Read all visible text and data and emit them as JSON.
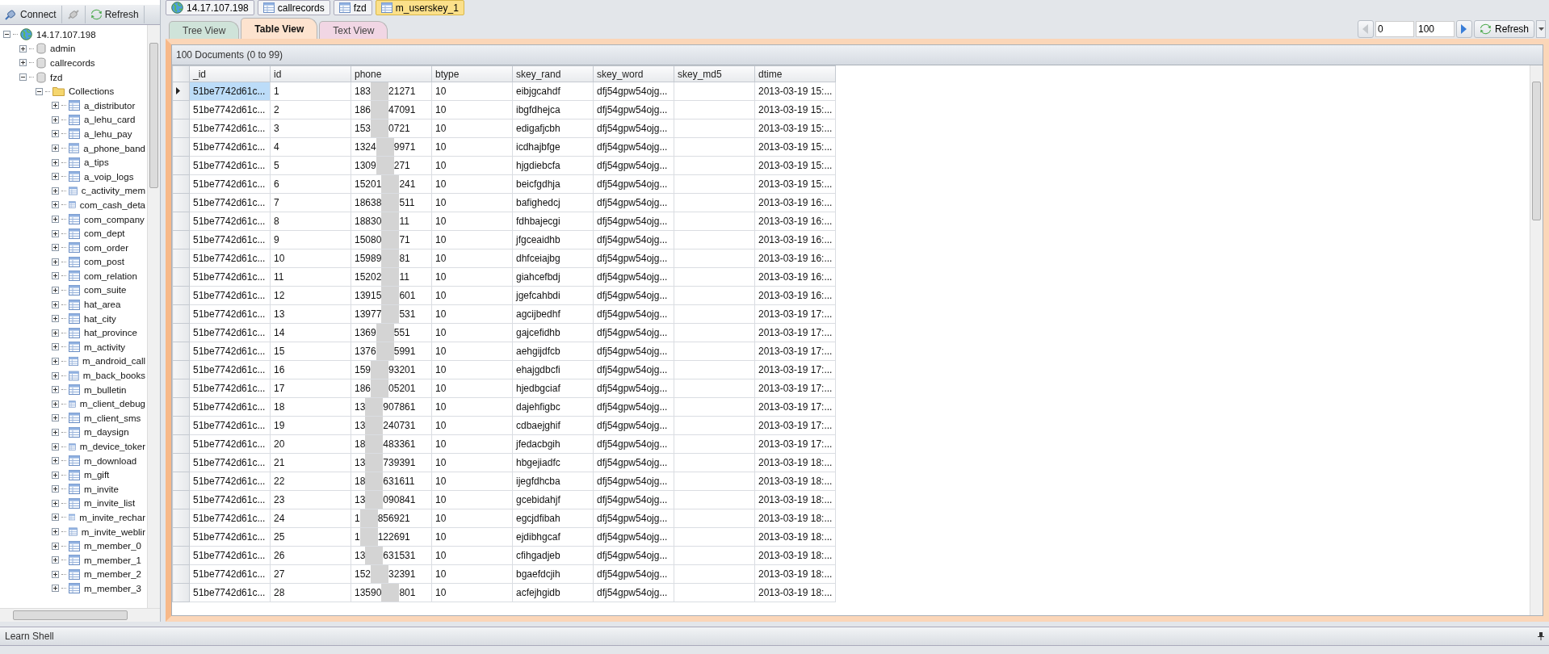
{
  "explorer": {
    "toolbar": [
      {
        "label": "Connect",
        "kind": "connect"
      },
      {
        "kind": "disconnect"
      },
      {
        "label": "Refresh",
        "kind": "refresh"
      }
    ],
    "tree": [
      {
        "label": "14.17.107.198",
        "kind": "server",
        "expanded": true,
        "children": [
          {
            "label": "admin",
            "kind": "database",
            "expanded": false
          },
          {
            "label": "callrecords",
            "kind": "database",
            "expanded": false
          },
          {
            "label": "fzd",
            "kind": "database",
            "expanded": true,
            "children": [
              {
                "label": "Collections",
                "kind": "folder",
                "expanded": true,
                "children": [
                  {
                    "label": "a_distributor",
                    "kind": "collection",
                    "expanded": false
                  },
                  {
                    "label": "a_lehu_card",
                    "kind": "collection",
                    "expanded": false
                  },
                  {
                    "label": "a_lehu_pay",
                    "kind": "collection",
                    "expanded": false
                  },
                  {
                    "label": "a_phone_band",
                    "kind": "collection",
                    "expanded": false
                  },
                  {
                    "label": "a_tips",
                    "kind": "collection",
                    "expanded": false
                  },
                  {
                    "label": "a_voip_logs",
                    "kind": "collection",
                    "expanded": false
                  },
                  {
                    "label": "c_activity_mem",
                    "kind": "collection",
                    "expanded": false
                  },
                  {
                    "label": "com_cash_deta",
                    "kind": "collection",
                    "expanded": false
                  },
                  {
                    "label": "com_company",
                    "kind": "collection",
                    "expanded": false
                  },
                  {
                    "label": "com_dept",
                    "kind": "collection",
                    "expanded": false
                  },
                  {
                    "label": "com_order",
                    "kind": "collection",
                    "expanded": false
                  },
                  {
                    "label": "com_post",
                    "kind": "collection",
                    "expanded": false
                  },
                  {
                    "label": "com_relation",
                    "kind": "collection",
                    "expanded": false
                  },
                  {
                    "label": "com_suite",
                    "kind": "collection",
                    "expanded": false
                  },
                  {
                    "label": "hat_area",
                    "kind": "collection",
                    "expanded": false
                  },
                  {
                    "label": "hat_city",
                    "kind": "collection",
                    "expanded": false
                  },
                  {
                    "label": "hat_province",
                    "kind": "collection",
                    "expanded": false
                  },
                  {
                    "label": "m_activity",
                    "kind": "collection",
                    "expanded": false
                  },
                  {
                    "label": "m_android_call",
                    "kind": "collection",
                    "expanded": false
                  },
                  {
                    "label": "m_back_books",
                    "kind": "collection",
                    "expanded": false
                  },
                  {
                    "label": "m_bulletin",
                    "kind": "collection",
                    "expanded": false
                  },
                  {
                    "label": "m_client_debug",
                    "kind": "collection",
                    "expanded": false
                  },
                  {
                    "label": "m_client_sms",
                    "kind": "collection",
                    "expanded": false
                  },
                  {
                    "label": "m_daysign",
                    "kind": "collection",
                    "expanded": false
                  },
                  {
                    "label": "m_device_toker",
                    "kind": "collection",
                    "expanded": false
                  },
                  {
                    "label": "m_download",
                    "kind": "collection",
                    "expanded": false
                  },
                  {
                    "label": "m_gift",
                    "kind": "collection",
                    "expanded": false
                  },
                  {
                    "label": "m_invite",
                    "kind": "collection",
                    "expanded": false
                  },
                  {
                    "label": "m_invite_list",
                    "kind": "collection",
                    "expanded": false
                  },
                  {
                    "label": "m_invite_rechar",
                    "kind": "collection",
                    "expanded": false
                  },
                  {
                    "label": "m_invite_weblir",
                    "kind": "collection",
                    "expanded": false
                  },
                  {
                    "label": "m_member_0",
                    "kind": "collection",
                    "expanded": false
                  },
                  {
                    "label": "m_member_1",
                    "kind": "collection",
                    "expanded": false
                  },
                  {
                    "label": "m_member_2",
                    "kind": "collection",
                    "expanded": false
                  },
                  {
                    "label": "m_member_3",
                    "kind": "collection",
                    "expanded": false
                  }
                ]
              }
            ]
          }
        ]
      }
    ]
  },
  "doc_tabs": [
    {
      "label": "14.17.107.198",
      "kind": "server",
      "selected": false
    },
    {
      "label": "callrecords",
      "kind": "collection",
      "selected": false
    },
    {
      "label": "fzd",
      "kind": "collection",
      "selected": false
    },
    {
      "label": "m_userskey_1",
      "kind": "collection",
      "selected": true
    }
  ],
  "view_tabs": [
    {
      "label": "Tree View",
      "color": "#cfe3d9",
      "selected": false
    },
    {
      "label": "Table View",
      "color": "#fde3cf",
      "selected": true
    },
    {
      "label": "Text View",
      "color": "#f1d6e4",
      "selected": false
    }
  ],
  "pager": {
    "skip": "0",
    "limit": "100",
    "refresh": "Refresh"
  },
  "table": {
    "summary": "100 Documents (0 to 99)",
    "columns": [
      "_id",
      "id",
      "phone",
      "btype",
      "skey_rand",
      "skey_word",
      "skey_md5",
      "dtime"
    ],
    "rows": [
      {
        "selected": true,
        "cells": [
          "51be7742d61c...",
          "1",
          "",
          "10",
          "eibjgcahdf",
          "dfj54gpw54ojg...",
          "",
          "2013-03-19 15:..."
        ],
        "phone": [
          "183",
          "21271"
        ]
      },
      {
        "selected": false,
        "cells": [
          "51be7742d61c...",
          "2",
          "",
          "10",
          "ibgfdhejca",
          "dfj54gpw54ojg...",
          "",
          "2013-03-19 15:..."
        ],
        "phone": [
          "186",
          "47091"
        ]
      },
      {
        "selected": false,
        "cells": [
          "51be7742d61c...",
          "3",
          "",
          "10",
          "edigafjcbh",
          "dfj54gpw54ojg...",
          "",
          "2013-03-19 15:..."
        ],
        "phone": [
          "153",
          "0721"
        ]
      },
      {
        "selected": false,
        "cells": [
          "51be7742d61c...",
          "4",
          "",
          "10",
          "icdhajbfge",
          "dfj54gpw54ojg...",
          "",
          "2013-03-19 15:..."
        ],
        "phone": [
          "1324",
          "9971"
        ]
      },
      {
        "selected": false,
        "cells": [
          "51be7742d61c...",
          "5",
          "",
          "10",
          "hjgdiebcfa",
          "dfj54gpw54ojg...",
          "",
          "2013-03-19 15:..."
        ],
        "phone": [
          "1309",
          "271"
        ]
      },
      {
        "selected": false,
        "cells": [
          "51be7742d61c...",
          "6",
          "",
          "10",
          "beicfgdhja",
          "dfj54gpw54ojg...",
          "",
          "2013-03-19 15:..."
        ],
        "phone": [
          "15201",
          "241"
        ]
      },
      {
        "selected": false,
        "cells": [
          "51be7742d61c...",
          "7",
          "",
          "10",
          "bafighedcj",
          "dfj54gpw54ojg...",
          "",
          "2013-03-19 16:..."
        ],
        "phone": [
          "18638",
          "511"
        ]
      },
      {
        "selected": false,
        "cells": [
          "51be7742d61c...",
          "8",
          "",
          "10",
          "fdhbajecgi",
          "dfj54gpw54ojg...",
          "",
          "2013-03-19 16:..."
        ],
        "phone": [
          "18830",
          "11"
        ]
      },
      {
        "selected": false,
        "cells": [
          "51be7742d61c...",
          "9",
          "",
          "10",
          "jfgceaidhb",
          "dfj54gpw54ojg...",
          "",
          "2013-03-19 16:..."
        ],
        "phone": [
          "15080",
          "71"
        ]
      },
      {
        "selected": false,
        "cells": [
          "51be7742d61c...",
          "10",
          "",
          "10",
          "dhfceiajbg",
          "dfj54gpw54ojg...",
          "",
          "2013-03-19 16:..."
        ],
        "phone": [
          "15989",
          "81"
        ]
      },
      {
        "selected": false,
        "cells": [
          "51be7742d61c...",
          "11",
          "",
          "10",
          "giahcefbdj",
          "dfj54gpw54ojg...",
          "",
          "2013-03-19 16:..."
        ],
        "phone": [
          "15202",
          "11"
        ]
      },
      {
        "selected": false,
        "cells": [
          "51be7742d61c...",
          "12",
          "",
          "10",
          "jgefcahbdi",
          "dfj54gpw54ojg...",
          "",
          "2013-03-19 16:..."
        ],
        "phone": [
          "13915",
          "601"
        ]
      },
      {
        "selected": false,
        "cells": [
          "51be7742d61c...",
          "13",
          "",
          "10",
          "agcijbedhf",
          "dfj54gpw54ojg...",
          "",
          "2013-03-19 17:..."
        ],
        "phone": [
          "13977",
          "531"
        ]
      },
      {
        "selected": false,
        "cells": [
          "51be7742d61c...",
          "14",
          "",
          "10",
          "gajcefidhb",
          "dfj54gpw54ojg...",
          "",
          "2013-03-19 17:..."
        ],
        "phone": [
          "1369",
          "551"
        ]
      },
      {
        "selected": false,
        "cells": [
          "51be7742d61c...",
          "15",
          "",
          "10",
          "aehgijdfcb",
          "dfj54gpw54ojg...",
          "",
          "2013-03-19 17:..."
        ],
        "phone": [
          "1376",
          "5991"
        ]
      },
      {
        "selected": false,
        "cells": [
          "51be7742d61c...",
          "16",
          "",
          "10",
          "ehajgdbcfi",
          "dfj54gpw54ojg...",
          "",
          "2013-03-19 17:..."
        ],
        "phone": [
          "159",
          "93201"
        ]
      },
      {
        "selected": false,
        "cells": [
          "51be7742d61c...",
          "17",
          "",
          "10",
          "hjedbgciaf",
          "dfj54gpw54ojg...",
          "",
          "2013-03-19 17:..."
        ],
        "phone": [
          "186",
          "05201"
        ]
      },
      {
        "selected": false,
        "cells": [
          "51be7742d61c...",
          "18",
          "",
          "10",
          "dajehfigbc",
          "dfj54gpw54ojg...",
          "",
          "2013-03-19 17:..."
        ],
        "phone": [
          "13",
          "907861"
        ]
      },
      {
        "selected": false,
        "cells": [
          "51be7742d61c...",
          "19",
          "",
          "10",
          "cdbaejghif",
          "dfj54gpw54ojg...",
          "",
          "2013-03-19 17:..."
        ],
        "phone": [
          "13",
          "240731"
        ]
      },
      {
        "selected": false,
        "cells": [
          "51be7742d61c...",
          "20",
          "",
          "10",
          "jfedacbgih",
          "dfj54gpw54ojg...",
          "",
          "2013-03-19 17:..."
        ],
        "phone": [
          "18",
          "483361"
        ]
      },
      {
        "selected": false,
        "cells": [
          "51be7742d61c...",
          "21",
          "",
          "10",
          "hbgejiadfc",
          "dfj54gpw54ojg...",
          "",
          "2013-03-19 18:..."
        ],
        "phone": [
          "13",
          "739391"
        ]
      },
      {
        "selected": false,
        "cells": [
          "51be7742d61c...",
          "22",
          "",
          "10",
          "ijegfdhcba",
          "dfj54gpw54ojg...",
          "",
          "2013-03-19 18:..."
        ],
        "phone": [
          "18",
          "631611"
        ]
      },
      {
        "selected": false,
        "cells": [
          "51be7742d61c...",
          "23",
          "",
          "10",
          "gcebidahjf",
          "dfj54gpw54ojg...",
          "",
          "2013-03-19 18:..."
        ],
        "phone": [
          "13",
          "090841"
        ]
      },
      {
        "selected": false,
        "cells": [
          "51be7742d61c...",
          "24",
          "",
          "10",
          "egcjdfibah",
          "dfj54gpw54ojg...",
          "",
          "2013-03-19 18:..."
        ],
        "phone": [
          "1",
          "856921"
        ]
      },
      {
        "selected": false,
        "cells": [
          "51be7742d61c...",
          "25",
          "",
          "10",
          "ejdibhgcaf",
          "dfj54gpw54ojg...",
          "",
          "2013-03-19 18:..."
        ],
        "phone": [
          "1",
          "122691"
        ]
      },
      {
        "selected": false,
        "cells": [
          "51be7742d61c...",
          "26",
          "",
          "10",
          "cfihgadjeb",
          "dfj54gpw54ojg...",
          "",
          "2013-03-19 18:..."
        ],
        "phone": [
          "13",
          "631531"
        ]
      },
      {
        "selected": false,
        "cells": [
          "51be7742d61c...",
          "27",
          "",
          "10",
          "bgaefdcjih",
          "dfj54gpw54ojg...",
          "",
          "2013-03-19 18:..."
        ],
        "phone": [
          "152",
          "32391"
        ]
      },
      {
        "selected": false,
        "cells": [
          "51be7742d61c...",
          "28",
          "",
          "10",
          "acfejhgidb",
          "dfj54gpw54ojg...",
          "",
          "2013-03-19 18:..."
        ],
        "phone": [
          "13590",
          "801"
        ]
      }
    ]
  },
  "shell": {
    "title": "Learn Shell"
  }
}
